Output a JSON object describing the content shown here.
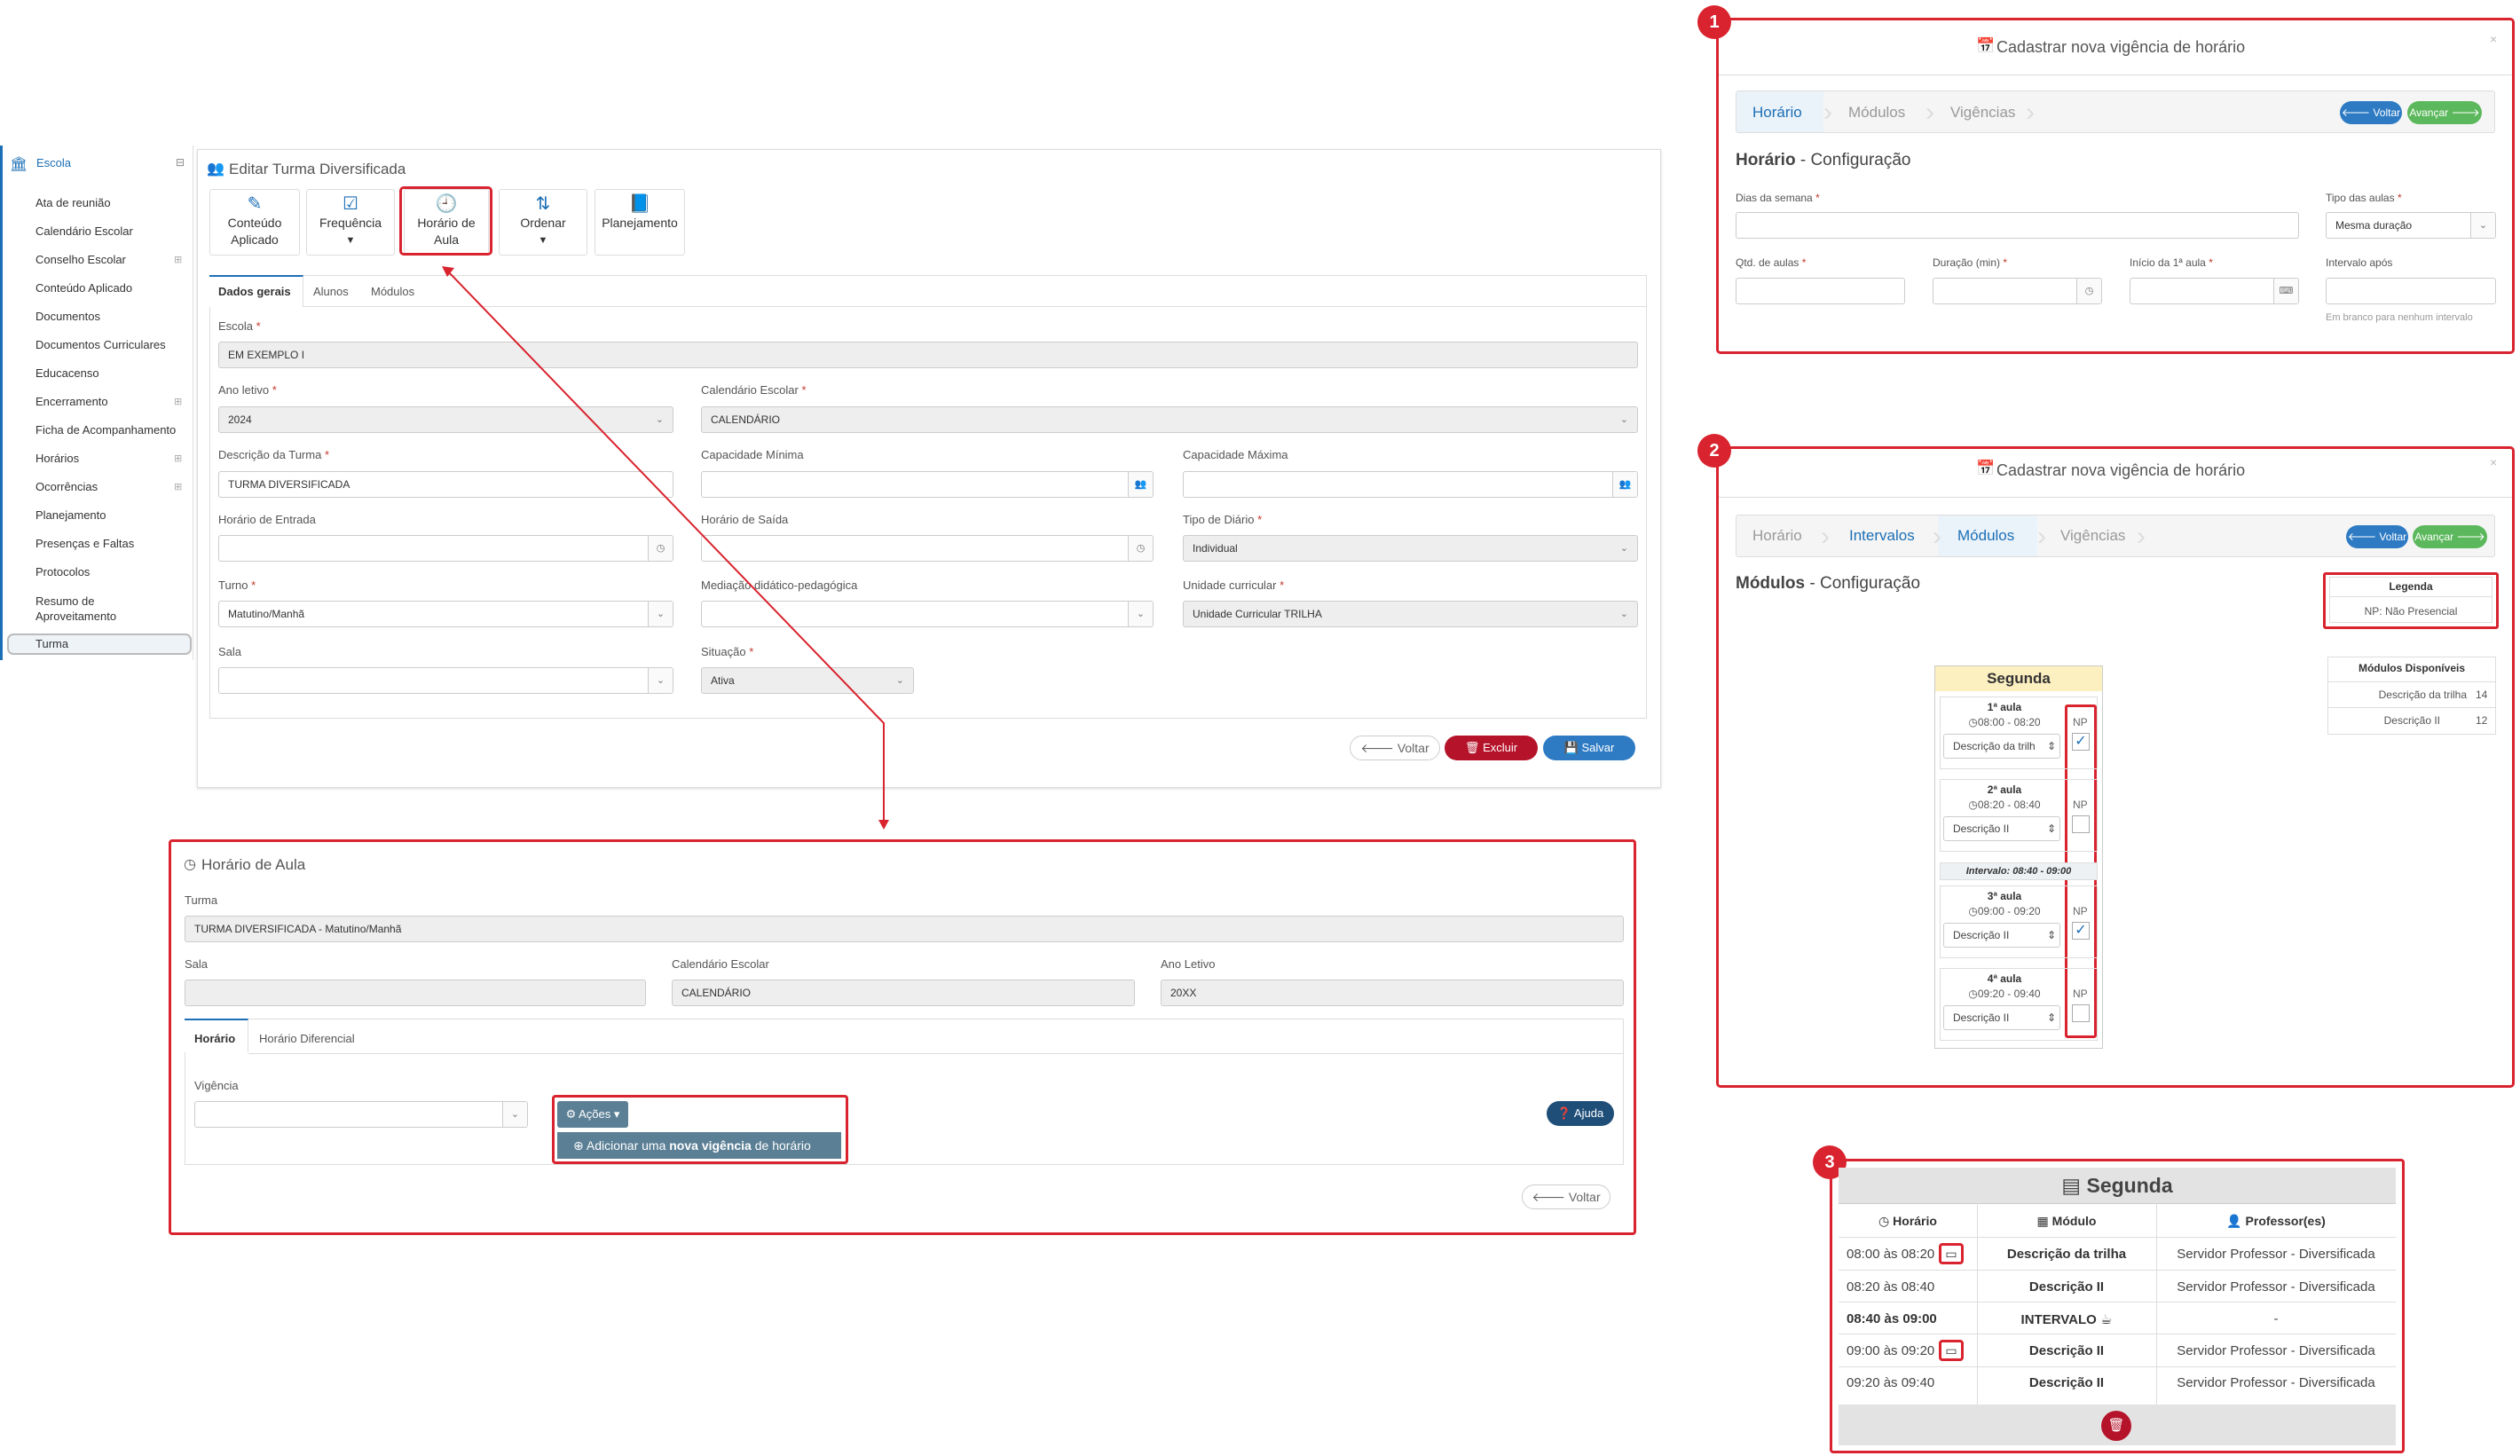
{
  "sidebar": {
    "header": "Escola",
    "items": [
      {
        "label": "Ata de reunião"
      },
      {
        "label": "Calendário Escolar"
      },
      {
        "label": "Conselho Escolar"
      },
      {
        "label": "Conteúdo Aplicado"
      },
      {
        "label": "Documentos"
      },
      {
        "label": "Documentos Curriculares"
      },
      {
        "label": "Educacenso"
      },
      {
        "label": "Encerramento"
      },
      {
        "label": "Ficha de Acompanhamento"
      },
      {
        "label": "Horários"
      },
      {
        "label": "Ocorrências"
      },
      {
        "label": "Planejamento"
      },
      {
        "label": "Presenças e Faltas"
      },
      {
        "label": "Protocolos"
      },
      {
        "label": "Resumo de Aproveitamento"
      },
      {
        "label": "Turma"
      }
    ]
  },
  "edit": {
    "title": "Editar Turma Diversificada",
    "toolbar": [
      "Conteúdo Aplicado",
      "Frequência",
      "Horário de Aula",
      "Ordenar",
      "Planejamento"
    ],
    "tabs": [
      "Dados gerais",
      "Alunos",
      "Módulos"
    ],
    "escola_label": "Escola",
    "escola_value": "EM EXEMPLO I",
    "ano_label": "Ano letivo",
    "ano_value": "2024",
    "calendario_label": "Calendário Escolar",
    "calendario_value": "CALENDÁRIO",
    "descricao_label": "Descrição da Turma",
    "descricao_value": "TURMA DIVERSIFICADA",
    "cap_min_label": "Capacidade Mínima",
    "cap_max_label": "Capacidade Máxima",
    "entrada_label": "Horário de Entrada",
    "saida_label": "Horário de Saída",
    "tipo_diario_label": "Tipo de Diário",
    "tipo_diario_value": "Individual",
    "turno_label": "Turno",
    "turno_value": "Matutino/Manhã",
    "mediacao_label": "Mediação didático-pedagógica",
    "unidade_label": "Unidade curricular",
    "unidade_value": "Unidade Curricular TRILHA",
    "sala_label": "Sala",
    "situacao_label": "Situação",
    "situacao_value": "Ativa",
    "btn_voltar": "Voltar",
    "btn_excluir": "Excluir",
    "btn_salvar": "Salvar"
  },
  "horario": {
    "title": "Horário de Aula",
    "turma_label": "Turma",
    "turma_value": "TURMA DIVERSIFICADA - Matutino/Manhã",
    "sala_label": "Sala",
    "calendario_label": "Calendário Escolar",
    "calendario_value": "CALENDÁRIO",
    "ano_label": "Ano Letivo",
    "ano_value": "20XX",
    "tabs": [
      "Horário",
      "Horário Diferencial"
    ],
    "vigencia_label": "Vigência",
    "acoes_label": "Ações",
    "menu_pre": "Adicionar uma ",
    "menu_bold": "nova vigência",
    "menu_post": " de horário",
    "ajuda_label": "Ajuda",
    "voltar_label": "Voltar"
  },
  "modal1": {
    "badge": "1",
    "title": "Cadastrar nova vigência de horário",
    "steps": [
      "Horário",
      "Módulos",
      "Vigências"
    ],
    "btn_voltar": "Voltar",
    "btn_avancar": "Avançar",
    "section_bold": "Horário",
    "section_rest": " - Configuração",
    "dias_label": "Dias da semana",
    "tipo_label": "Tipo das aulas",
    "tipo_value": "Mesma duração",
    "qtd_label": "Qtd. de aulas",
    "duracao_label": "Duração (min)",
    "inicio_label": "Início da 1ª aula",
    "intervalo_label": "Intervalo após",
    "intervalo_hint": "Em branco para nenhum intervalo"
  },
  "modal2": {
    "badge": "2",
    "title": "Cadastrar nova vigência de horário",
    "steps": [
      "Horário",
      "Intervalos",
      "Módulos",
      "Vigências"
    ],
    "btn_voltar": "Voltar",
    "btn_avancar": "Avançar",
    "section_bold": "Módulos",
    "section_rest": " - Configuração",
    "legenda_title": "Legenda",
    "legenda_text": "NP: Não Presencial",
    "disp_title": "Módulos Disponíveis",
    "disp_rows": [
      {
        "name": "Descrição da trilha",
        "count": "14"
      },
      {
        "name": "Descrição II",
        "count": "12"
      }
    ],
    "day": "Segunda",
    "np_label": "NP",
    "aulas": [
      {
        "title": "1ª aula",
        "time": "08:00 - 08:20",
        "module": "Descrição da trilh",
        "checked": true
      },
      {
        "title": "2ª aula",
        "time": "08:20 - 08:40",
        "module": "Descrição II",
        "checked": false
      },
      {
        "title": "3ª aula",
        "time": "09:00 - 09:20",
        "module": "Descrição II",
        "checked": true
      },
      {
        "title": "4ª aula",
        "time": "09:20 - 09:40",
        "module": "Descrição II",
        "checked": false
      }
    ],
    "intervalo": "Intervalo: 08:40 - 09:00"
  },
  "table3": {
    "badge": "3",
    "day": "Segunda",
    "headers": [
      "Horário",
      "Módulo",
      "Professor(es)"
    ],
    "rows": [
      {
        "time": "08:00 às 08:20",
        "module": "Descrição da trilha",
        "prof": "Servidor Professor - Diversificada"
      },
      {
        "time": "08:20 às 08:40",
        "module": "Descrição II",
        "prof": "Servidor Professor - Diversificada"
      },
      {
        "time": "08:40 às 09:00",
        "module": "INTERVALO",
        "prof": "-"
      },
      {
        "time": "09:00 às 09:20",
        "module": "Descrição II",
        "prof": "Servidor Professor - Diversificada"
      },
      {
        "time": "09:20 às 09:40",
        "module": "Descrição II",
        "prof": "Servidor Professor - Diversificada"
      }
    ]
  },
  "colors": {
    "primary": "#1c6fb5",
    "danger": "#b5132a",
    "success": "#5cb85c",
    "highlight": "#d9232e",
    "info": "#5b7f95"
  }
}
